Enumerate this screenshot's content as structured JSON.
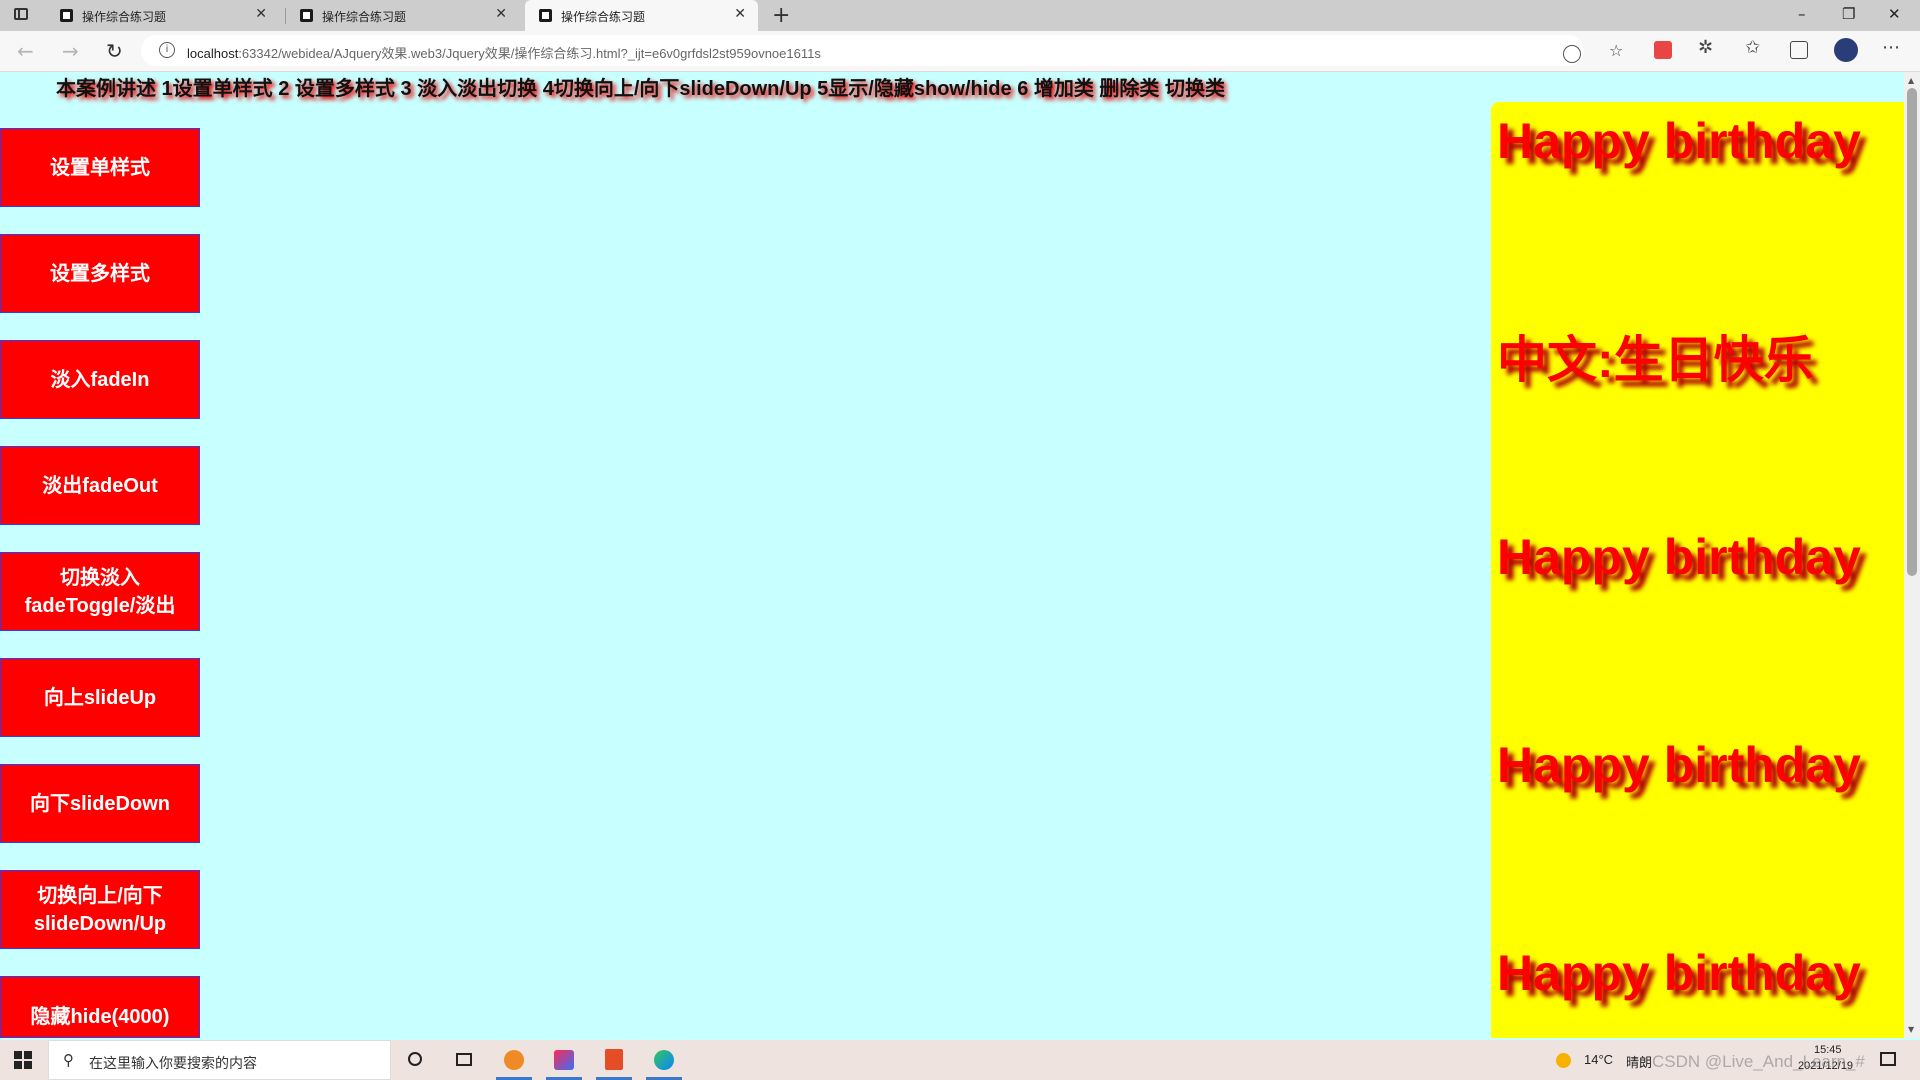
{
  "browser": {
    "tabs": [
      {
        "title": "操作综合练习题",
        "close": "✕"
      },
      {
        "title": "操作综合练习题",
        "close": "✕"
      },
      {
        "title": "操作综合练习题",
        "close": "✕"
      }
    ],
    "new_tab": "+",
    "window_controls": {
      "minimize": "–",
      "restore": "❐",
      "close": "✕"
    },
    "url_host": "localhost",
    "url_rest": ":63342/webidea/AJquery效果.web3/Jquery效果/操作综合练习.html?_ijt=e6v0grfdsl2st959ovnoe1611s"
  },
  "page": {
    "headline": "本案例讲述 1设置单样式 2 设置多样式 3 淡入淡出切换 4切换向上/向下slideDown/Up 5显示/隐藏show/hide 6 增加类 删除类 切换类",
    "buttons": [
      "设置单样式",
      "设置多样式",
      "淡入fadeIn",
      "淡出fadeOut",
      "切换淡入\nfadeToggle/淡出",
      "向上slideUp",
      "向下slideDown",
      "切换向上/向下\nslideDown/Up",
      "隐藏hide(4000)"
    ],
    "side_panel": [
      "Happy birthday",
      "中文:生日快乐",
      "Happy birthday",
      "Happy birthday",
      "Happy birthday"
    ]
  },
  "taskbar": {
    "search_placeholder": "在这里输入你要搜索的内容",
    "weather_temp": "14°C",
    "weather_desc": "晴朗",
    "time": "15:45",
    "date": "2021/12/19",
    "watermark": "CSDN @Live_And_Learn_#"
  },
  "colors": {
    "page_bg": "#c8ffff",
    "button_bg": "#ff0000",
    "button_border": "#2b3cff",
    "panel_bg": "#ffff00",
    "panel_text": "#ff0000"
  }
}
